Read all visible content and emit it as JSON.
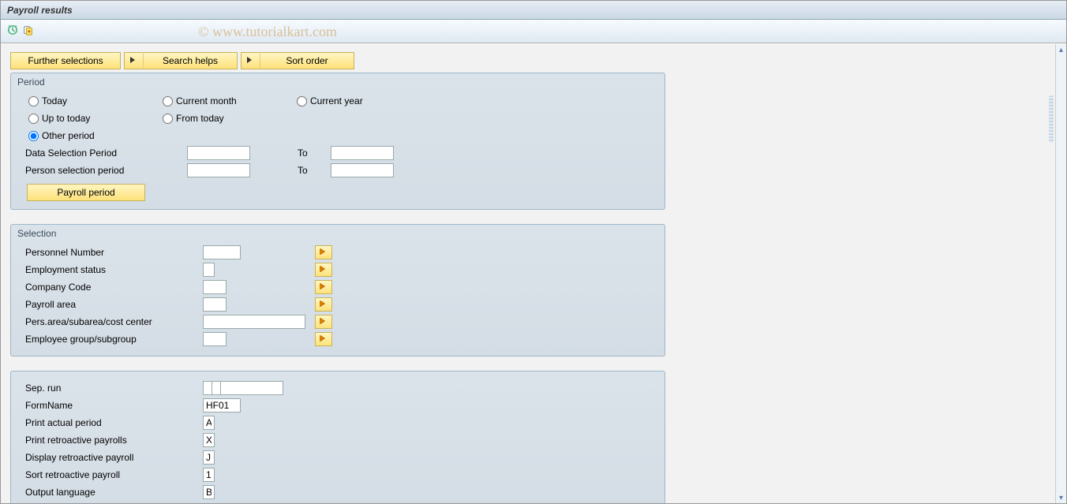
{
  "header": {
    "title": "Payroll results"
  },
  "watermark": "© www.tutorialkart.com",
  "topButtons": {
    "further": "Further selections",
    "searchHelps": "Search helps",
    "sortOrder": "Sort order"
  },
  "period": {
    "title": "Period",
    "today": "Today",
    "currentMonth": "Current month",
    "currentYear": "Current year",
    "upToToday": "Up to today",
    "fromToday": "From today",
    "otherPeriod": "Other period",
    "dataSelPeriod": "Data Selection Period",
    "personSelPeriod": "Person selection period",
    "to": "To",
    "payrollPeriodBtn": "Payroll period"
  },
  "selection": {
    "title": "Selection",
    "rows": [
      {
        "label": "Personnel Number",
        "width": "w48"
      },
      {
        "label": "Employment status",
        "width": "w15"
      },
      {
        "label": "Company Code",
        "width": "w30"
      },
      {
        "label": "Payroll area",
        "width": "w30"
      },
      {
        "label": "Pers.area/subarea/cost center",
        "width": "w130"
      },
      {
        "label": "Employee group/subgroup",
        "width": "w30"
      }
    ]
  },
  "options": {
    "sepRun": {
      "label": "Sep. run",
      "v": ""
    },
    "formName": {
      "label": "FormName",
      "v": "HF01"
    },
    "printActual": {
      "label": "Print actual period",
      "v": "A"
    },
    "printRetro": {
      "label": "Print retroactive payrolls",
      "v": "X"
    },
    "dispRetro": {
      "label": "Display retroactive payroll",
      "v": "J"
    },
    "sortRetro": {
      "label": "Sort retroactive payroll",
      "v": "1"
    },
    "outLang": {
      "label": "Output language",
      "v": "B"
    }
  }
}
